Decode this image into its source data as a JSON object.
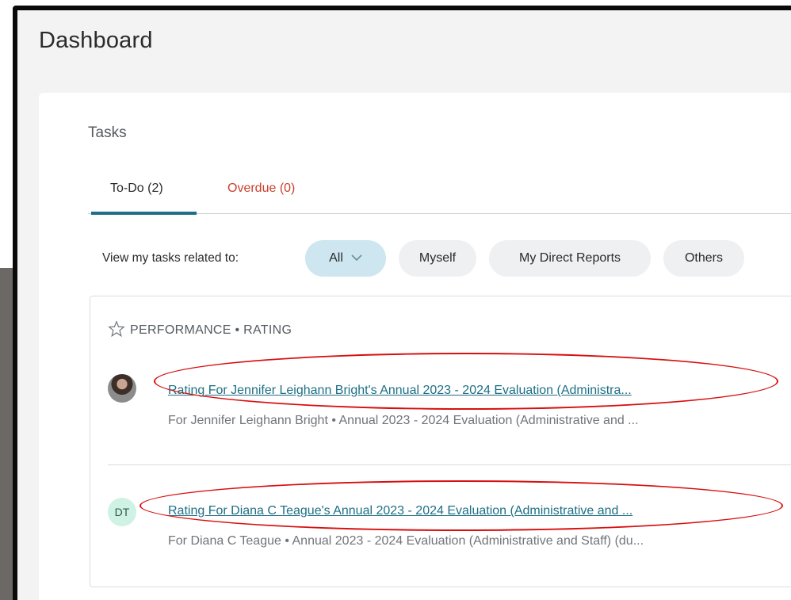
{
  "page": {
    "title": "Dashboard"
  },
  "tasks": {
    "title": "Tasks",
    "tabs": [
      {
        "label": "To-Do (2)",
        "active": true
      },
      {
        "label": "Overdue (0)",
        "active": false
      }
    ],
    "filter": {
      "label": "View my tasks related to:",
      "chips": [
        {
          "label": "All",
          "active": true,
          "icon": "chevron-down-icon"
        },
        {
          "label": "Myself",
          "active": false
        },
        {
          "label": "My Direct Reports",
          "active": false
        },
        {
          "label": "Others",
          "active": false
        }
      ]
    },
    "section": {
      "heading": "PERFORMANCE • RATING",
      "icon": "star-icon"
    },
    "items": [
      {
        "avatar_type": "photo",
        "title": "Rating For Jennifer Leighann Bright's Annual 2023 - 2024 Evaluation (Administra...",
        "subtitle": "For Jennifer Leighann Bright • Annual 2023 - 2024 Evaluation (Administrative and ..."
      },
      {
        "avatar_type": "initials",
        "initials": "DT",
        "title": "Rating For Diana C Teague's Annual 2023 - 2024 Evaluation (Administrative and ...",
        "subtitle": "For Diana C Teague • Annual 2023 - 2024 Evaluation (Administrative and Staff) (du..."
      }
    ]
  },
  "colors": {
    "accent": "#1e6f86",
    "overdue": "#c9412e",
    "annotation": "#d80f0f",
    "chip_active": "#cde6ef",
    "chip": "#eef0f1"
  }
}
